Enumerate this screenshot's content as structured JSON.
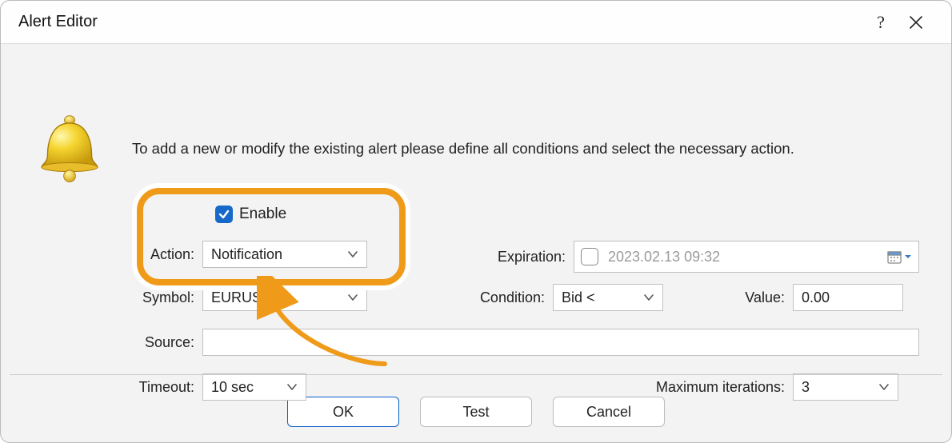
{
  "window": {
    "title": "Alert Editor"
  },
  "intro": "To add a new or modify the existing alert please define all conditions and select the necessary action.",
  "form": {
    "enable_label": "Enable",
    "action_label": "Action:",
    "action_value": "Notification",
    "symbol_label": "Symbol:",
    "symbol_value": "EURUSD",
    "source_label": "Source:",
    "source_value": "",
    "timeout_label": "Timeout:",
    "timeout_value": "10 sec",
    "expiration_label": "Expiration:",
    "expiration_value": "2023.02.13 09:32",
    "condition_label": "Condition:",
    "condition_value": "Bid <",
    "value_label": "Value:",
    "value_value": "0.00",
    "maxiter_label": "Maximum iterations:",
    "maxiter_value": "3"
  },
  "buttons": {
    "ok": "OK",
    "test": "Test",
    "cancel": "Cancel"
  }
}
